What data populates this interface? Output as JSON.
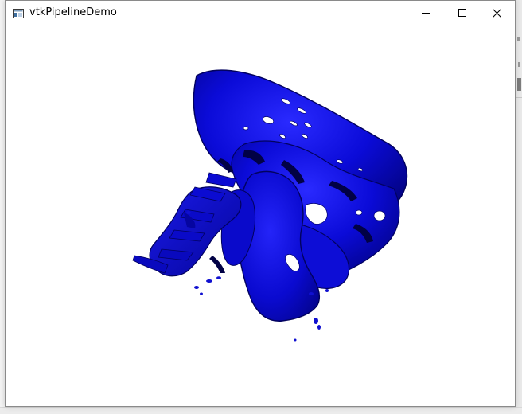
{
  "window": {
    "title": "vtkPipelineDemo"
  },
  "icons": {
    "app": "app-window-icon",
    "minimize": "minimize-icon",
    "maximize": "maximize-icon",
    "close": "close-icon"
  },
  "render": {
    "model": "skull-isosurface",
    "surface_color": "#0a0ae0",
    "background_color": "#ffffff"
  }
}
